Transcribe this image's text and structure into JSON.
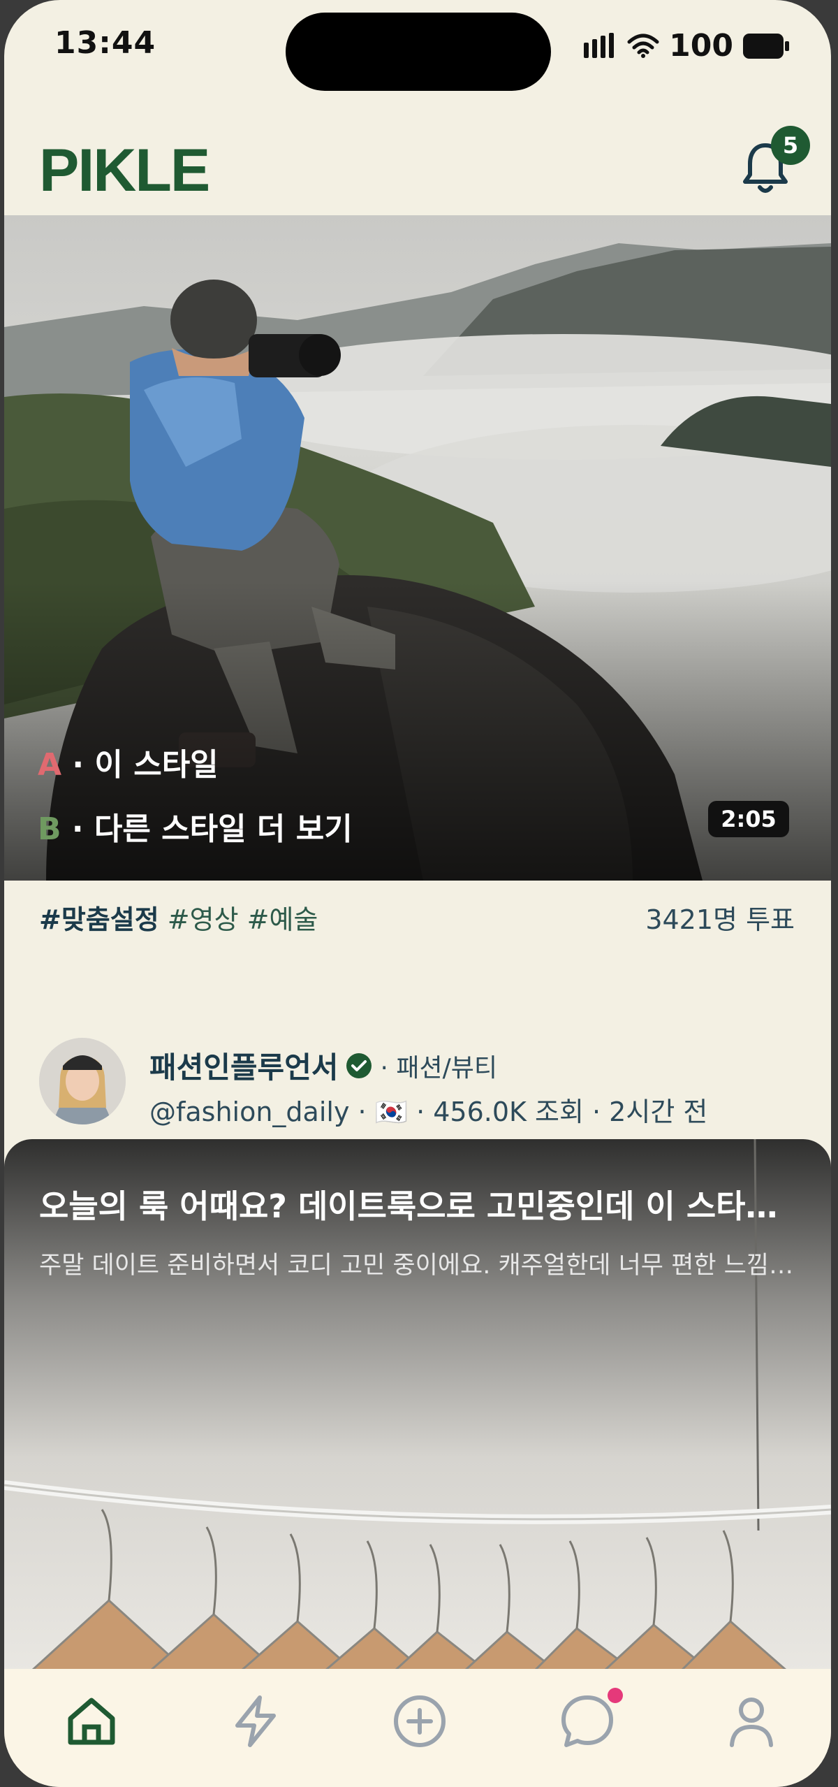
{
  "status_bar": {
    "time": "13:44",
    "battery": "100"
  },
  "header": {
    "logo": "PIKLE",
    "notification_count": "5"
  },
  "hero": {
    "option_a_letter": "A",
    "option_a_text": " · 이 스타일",
    "option_b_letter": "B",
    "option_b_text": " · 다른 스타일 더 보기",
    "duration": "2:05"
  },
  "tags": {
    "primary": "#맞춤설정",
    "others": " #영상 #예술"
  },
  "votes": "3421명 투표",
  "author": {
    "name": "패션인플루언서",
    "category": "· 패션/뷰티",
    "meta": "@fashion_daily · 🇰🇷 · 456.0K 조회 · 2시간 전"
  },
  "post": {
    "title": "오늘의 룩 어때요? 데이트룩으로 고민중인데 이 스타일 어떤가요?",
    "description": "주말 데이트 준비하면서 코디 고민 중이에요. 캐주얼한데 너무 편한 느낌인지 궁금해요"
  },
  "tabbar": {
    "items": [
      "home-icon",
      "lightning-icon",
      "plus-circle-icon",
      "chat-icon",
      "profile-icon"
    ],
    "active_color": "#1f5a32",
    "inactive_color": "#9aa3ad"
  }
}
